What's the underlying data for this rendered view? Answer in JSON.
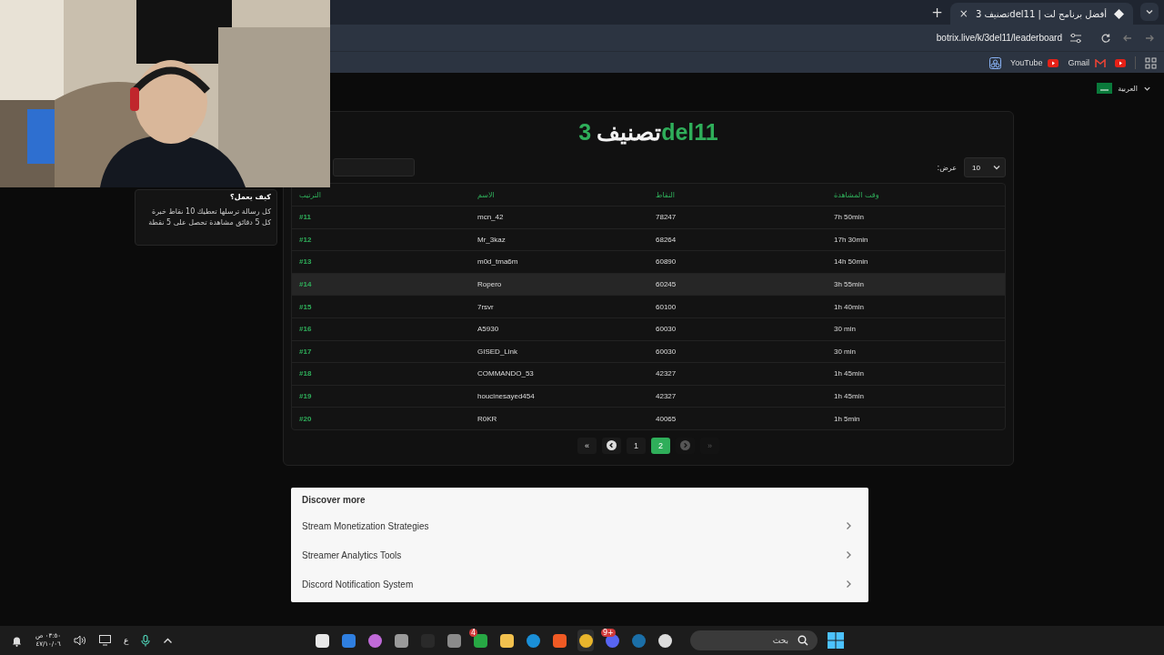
{
  "browser": {
    "tabs": [
      {
        "title": "تصنيف 3del11 | أفضل برنامج لت",
        "selected": true
      }
    ],
    "new_tab": "+",
    "tab_close": "×",
    "url": "botrix.live/k/3del11/leaderboard",
    "bookmarks": [
      {
        "label": "YouTube"
      },
      {
        "label": "Gmail"
      }
    ]
  },
  "page": {
    "language": "العربية",
    "title_parts": [
      {
        "text": "3",
        "accent": true
      },
      {
        "text": "تصنيف",
        "accent": false
      },
      {
        "text": "del11",
        "accent": true
      }
    ],
    "sidebar": {
      "heading": "كيف يعمل؟",
      "lines": [
        "كل رسالة ترسلها تعطيك 10 نقاط خبرة",
        "كل 5 دقائق مشاهدة تحصل على 5 نقطة"
      ]
    },
    "show_label": ":عرض",
    "page_size": "10",
    "table": {
      "columns": [
        "الترتيب",
        "الاسم",
        "النقاط",
        "وقت المشاهدة"
      ],
      "rows": [
        {
          "cells": [
            "#11",
            "mcn_42",
            "78247",
            "7h 50min"
          ],
          "hovered": false
        },
        {
          "cells": [
            "#12",
            "Mr_3kaz",
            "68264",
            "17h 30min"
          ],
          "hovered": false
        },
        {
          "cells": [
            "#13",
            "m0d_tma6m",
            "60890",
            "14h 50min"
          ],
          "hovered": false
        },
        {
          "cells": [
            "#14",
            "Ropero",
            "60245",
            "3h 55min"
          ],
          "hovered": true
        },
        {
          "cells": [
            "#15",
            "7rsvr",
            "60100",
            "1h 40min"
          ],
          "hovered": false
        },
        {
          "cells": [
            "#16",
            "A5930",
            "60030",
            "30 min"
          ],
          "hovered": false
        },
        {
          "cells": [
            "#17",
            "GISED_Link",
            "60030",
            "30 min"
          ],
          "hovered": false
        },
        {
          "cells": [
            "#18",
            "COMMANDO_53",
            "42327",
            "1h 45min"
          ],
          "hovered": false
        },
        {
          "cells": [
            "#19",
            "houcinesayed454",
            "42327",
            "1h 45min"
          ],
          "hovered": false
        },
        {
          "cells": [
            "#20",
            "R0KR",
            "40065",
            "1h 5min"
          ],
          "hovered": false
        }
      ]
    },
    "pagination": [
      {
        "kind": "first",
        "label": "«",
        "disabled": false
      },
      {
        "kind": "prev",
        "disabled": false
      },
      {
        "kind": "page",
        "label": "1",
        "selected": false
      },
      {
        "kind": "page",
        "label": "2",
        "selected": true
      },
      {
        "kind": "next",
        "disabled": true
      },
      {
        "kind": "last",
        "label": "»",
        "disabled": true
      }
    ],
    "discover": {
      "title": "Discover more",
      "items": [
        "Stream Monetization Strategies",
        "Streamer Analytics Tools",
        "Discord Notification System"
      ]
    }
  },
  "taskbar": {
    "time": "٠٣:٥٠ ص",
    "date": "٤٧/١٠/٠٦",
    "input_language": "ع",
    "search_placeholder": "بحث",
    "apps": [
      {
        "kind": "store"
      },
      {
        "kind": "mail"
      },
      {
        "kind": "copilot"
      },
      {
        "kind": "windows"
      },
      {
        "kind": "ctrl"
      },
      {
        "kind": "cube"
      },
      {
        "kind": "xbox",
        "badge": "4"
      },
      {
        "kind": "folder"
      },
      {
        "kind": "edge"
      },
      {
        "kind": "brave"
      },
      {
        "kind": "chrome",
        "active": true
      },
      {
        "kind": "discord",
        "badge": "9+"
      },
      {
        "kind": "steam"
      },
      {
        "kind": "obs"
      }
    ]
  }
}
